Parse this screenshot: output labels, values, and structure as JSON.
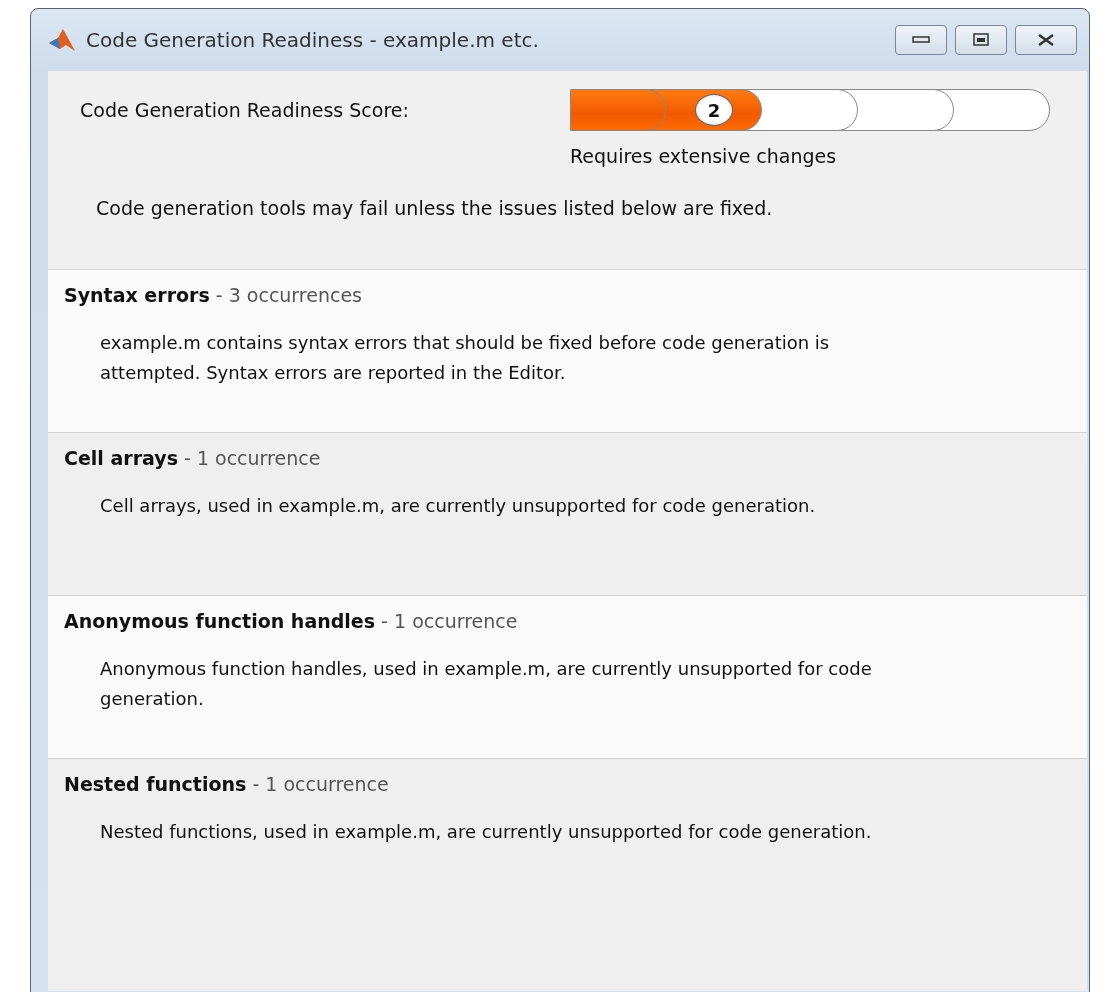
{
  "window": {
    "title": "Code Generation Readiness - example.m etc."
  },
  "score": {
    "label": "Code Generation Readiness Score:",
    "segments": [
      {
        "filled": true
      },
      {
        "filled": true
      },
      {
        "filled": false
      },
      {
        "filled": false
      },
      {
        "filled": false
      }
    ],
    "badge": "2",
    "verdict": "Requires extensive changes"
  },
  "message": "Code generation tools may fail unless the issues listed below are fixed.",
  "issues": [
    {
      "title": "Syntax errors",
      "count": "- 3 occurrences",
      "description": "example.m contains syntax errors that should be fixed before code generation is attempted. Syntax errors are reported in the Editor."
    },
    {
      "title": "Cell arrays",
      "count": "- 1 occurrence",
      "description": "Cell arrays, used in example.m, are currently unsupported for code generation."
    },
    {
      "title": "Anonymous function handles",
      "count": "- 1 occurrence",
      "description": "Anonymous function handles, used in example.m, are currently unsupported for code generation."
    },
    {
      "title": "Nested functions",
      "count": "- 1 occurrence",
      "description": "Nested functions, used in example.m, are currently unsupported for code generation."
    }
  ]
}
